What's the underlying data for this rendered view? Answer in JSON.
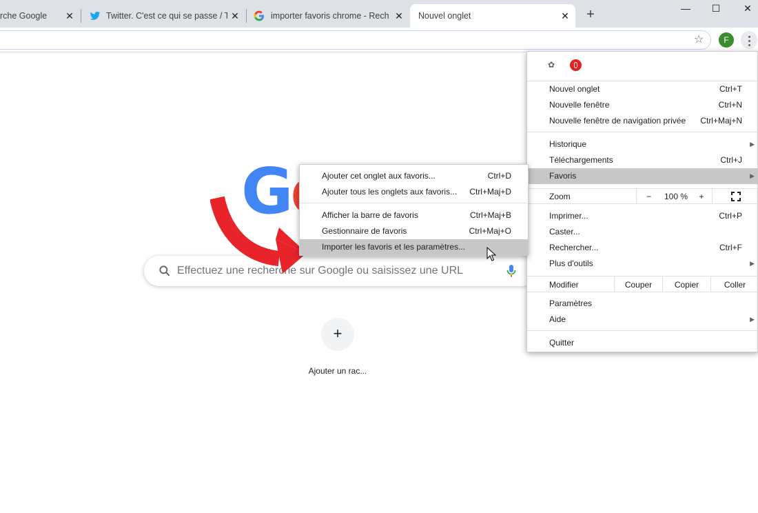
{
  "tabs": [
    {
      "title": "rche Google"
    },
    {
      "title": "Twitter. C'est ce qui se passe / Tw"
    },
    {
      "title": "importer favoris chrome - Recher"
    },
    {
      "title": "Nouvel onglet"
    }
  ],
  "toolbar": {
    "avatar_letter": "F"
  },
  "ntp": {
    "search_placeholder": "Effectuez une recherche sur Google ou saisissez une URL",
    "shortcut_label": "Ajouter un rac..."
  },
  "menu": {
    "items_top": [
      {
        "label": "Nouvel onglet",
        "shortcut": "Ctrl+T"
      },
      {
        "label": "Nouvelle fenêtre",
        "shortcut": "Ctrl+N"
      },
      {
        "label": "Nouvelle fenêtre de navigation privée",
        "shortcut": "Ctrl+Maj+N"
      }
    ],
    "items_history": [
      {
        "label": "Historique",
        "shortcut": ""
      },
      {
        "label": "Téléchargements",
        "shortcut": "Ctrl+J"
      },
      {
        "label": "Favoris",
        "shortcut": ""
      }
    ],
    "zoom": {
      "label": "Zoom",
      "minus": "−",
      "value": "100 %",
      "plus": "+"
    },
    "items_tools": [
      {
        "label": "Imprimer...",
        "shortcut": "Ctrl+P"
      },
      {
        "label": "Caster...",
        "shortcut": ""
      },
      {
        "label": "Rechercher...",
        "shortcut": "Ctrl+F"
      },
      {
        "label": "Plus d'outils",
        "shortcut": ""
      }
    ],
    "edit": {
      "label": "Modifier",
      "cut": "Couper",
      "copy": "Copier",
      "paste": "Coller"
    },
    "items_settings": [
      {
        "label": "Paramètres"
      },
      {
        "label": "Aide"
      }
    ],
    "quit": "Quitter"
  },
  "submenu": {
    "items": [
      {
        "label": "Ajouter cet onglet aux favoris...",
        "shortcut": "Ctrl+D"
      },
      {
        "label": "Ajouter tous les onglets aux favoris...",
        "shortcut": "Ctrl+Maj+D"
      },
      {
        "label": "Afficher la barre de favoris",
        "shortcut": "Ctrl+Maj+B"
      },
      {
        "label": "Gestionnaire de favoris",
        "shortcut": "Ctrl+Maj+O"
      },
      {
        "label": "Importer les favoris et les paramètres...",
        "shortcut": ""
      }
    ]
  },
  "colors": {
    "arrow": "#e8232a",
    "highlight": "#c7c7c7",
    "google_blue": "#4285f4",
    "google_red": "#ea4335"
  }
}
